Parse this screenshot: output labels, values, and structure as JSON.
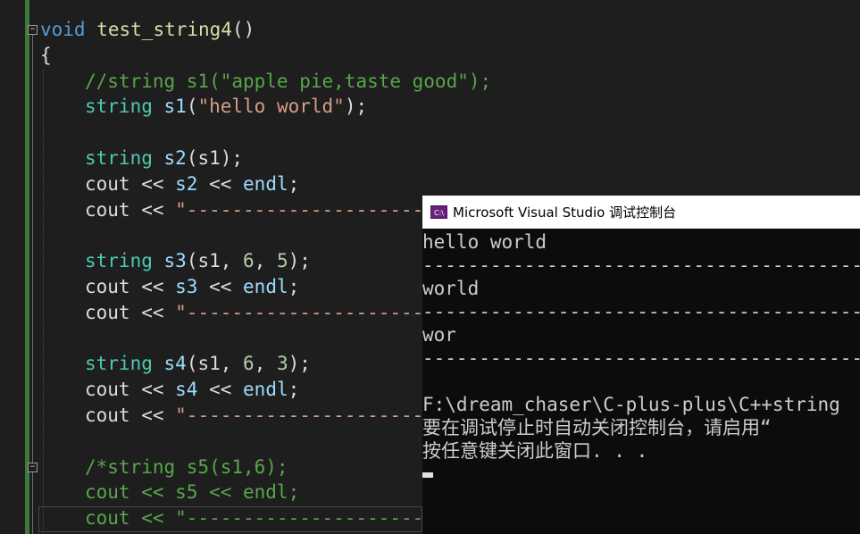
{
  "editor": {
    "lines": [
      {
        "tokens": [
          {
            "c": "kw",
            "t": "void"
          },
          {
            "c": "punc",
            "t": " "
          },
          {
            "c": "fn",
            "t": "test_string4"
          },
          {
            "c": "punc",
            "t": "()"
          }
        ]
      },
      {
        "tokens": [
          {
            "c": "punc",
            "t": "{"
          }
        ]
      },
      {
        "indent": true,
        "tokens": [
          {
            "c": "cm",
            "t": "//string s1(\"apple pie,taste good\");"
          }
        ]
      },
      {
        "indent": true,
        "tokens": [
          {
            "c": "ty",
            "t": "string"
          },
          {
            "c": "punc",
            "t": " "
          },
          {
            "c": "var",
            "t": "s1"
          },
          {
            "c": "punc",
            "t": "("
          },
          {
            "c": "str",
            "t": "\"hello world\""
          },
          {
            "c": "punc",
            "t": ");"
          }
        ]
      },
      {
        "tokens": []
      },
      {
        "indent": true,
        "tokens": [
          {
            "c": "ty",
            "t": "string"
          },
          {
            "c": "punc",
            "t": " "
          },
          {
            "c": "var",
            "t": "s2"
          },
          {
            "c": "punc",
            "t": "(s1);"
          }
        ]
      },
      {
        "indent": true,
        "tokens": [
          {
            "c": "punc",
            "t": "cout << "
          },
          {
            "c": "var",
            "t": "s2"
          },
          {
            "c": "punc",
            "t": " << "
          },
          {
            "c": "var",
            "t": "endl"
          },
          {
            "c": "punc",
            "t": ";"
          }
        ]
      },
      {
        "indent": true,
        "tokens": [
          {
            "c": "punc",
            "t": "cout << "
          },
          {
            "c": "str",
            "t": "\"---------------------"
          }
        ]
      },
      {
        "tokens": []
      },
      {
        "indent": true,
        "tokens": [
          {
            "c": "ty",
            "t": "string"
          },
          {
            "c": "punc",
            "t": " "
          },
          {
            "c": "var",
            "t": "s3"
          },
          {
            "c": "punc",
            "t": "(s1, "
          },
          {
            "c": "num",
            "t": "6"
          },
          {
            "c": "punc",
            "t": ", "
          },
          {
            "c": "num",
            "t": "5"
          },
          {
            "c": "punc",
            "t": ");"
          }
        ]
      },
      {
        "indent": true,
        "tokens": [
          {
            "c": "punc",
            "t": "cout << "
          },
          {
            "c": "var",
            "t": "s3"
          },
          {
            "c": "punc",
            "t": " << "
          },
          {
            "c": "var",
            "t": "endl"
          },
          {
            "c": "punc",
            "t": ";"
          }
        ]
      },
      {
        "indent": true,
        "tokens": [
          {
            "c": "punc",
            "t": "cout << "
          },
          {
            "c": "str",
            "t": "\"---------------------"
          }
        ]
      },
      {
        "tokens": []
      },
      {
        "indent": true,
        "tokens": [
          {
            "c": "ty",
            "t": "string"
          },
          {
            "c": "punc",
            "t": " "
          },
          {
            "c": "var",
            "t": "s4"
          },
          {
            "c": "punc",
            "t": "(s1, "
          },
          {
            "c": "num",
            "t": "6"
          },
          {
            "c": "punc",
            "t": ", "
          },
          {
            "c": "num",
            "t": "3"
          },
          {
            "c": "punc",
            "t": ");"
          }
        ]
      },
      {
        "indent": true,
        "tokens": [
          {
            "c": "punc",
            "t": "cout << "
          },
          {
            "c": "var",
            "t": "s4"
          },
          {
            "c": "punc",
            "t": " << "
          },
          {
            "c": "var",
            "t": "endl"
          },
          {
            "c": "punc",
            "t": ";"
          }
        ]
      },
      {
        "indent": true,
        "tokens": [
          {
            "c": "punc",
            "t": "cout << "
          },
          {
            "c": "str",
            "t": "\"---------------------"
          }
        ]
      },
      {
        "tokens": []
      },
      {
        "indent": true,
        "tokens": [
          {
            "c": "cm",
            "t": "/*string s5(s1,6);"
          }
        ]
      },
      {
        "indent": true,
        "tokens": [
          {
            "c": "cm",
            "t": "cout << s5 << endl;"
          }
        ]
      },
      {
        "indent": true,
        "tokens": [
          {
            "c": "cm",
            "t": "cout << \"---------------------"
          }
        ]
      }
    ]
  },
  "console": {
    "title": "Microsoft Visual Studio 调试控制台",
    "icon_label": "C:\\",
    "lines": [
      "hello world",
      "----------------------------------------",
      "world",
      "----------------------------------------",
      "wor",
      "----------------------------------------",
      "",
      "F:\\dream_chaser\\C-plus-plus\\C++string",
      "要在调试停止时自动关闭控制台，请启用“",
      "按任意键关闭此窗口. . ."
    ]
  },
  "colors": {
    "editor_bg": "#1e1e1e",
    "keyword": "#569cd6",
    "function": "#dcdcaa",
    "type": "#4ec9b0",
    "variable": "#9cdcfe",
    "string": "#d69d85",
    "comment": "#57a64a",
    "console_bg": "#0c0c0c"
  }
}
